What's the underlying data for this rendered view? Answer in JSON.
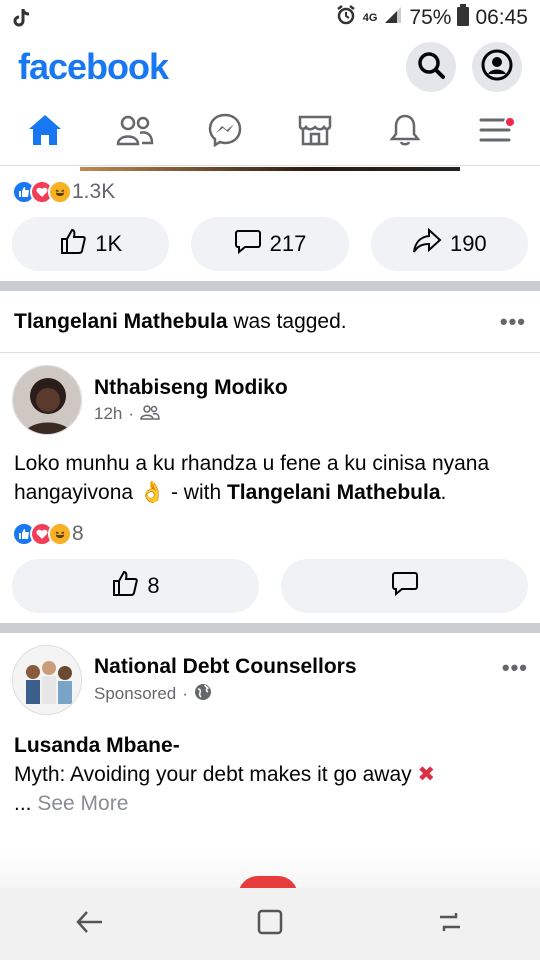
{
  "status": {
    "network": "4G",
    "battery": "75%",
    "time": "06:45"
  },
  "header": {
    "logo": "facebook",
    "search_icon": "search-icon",
    "profile_icon": "profile-icon"
  },
  "tabs": [
    "home-icon",
    "friends-icon",
    "messenger-icon",
    "marketplace-icon",
    "notifications-icon",
    "menu-icon"
  ],
  "post1": {
    "reaction_count": "1.3K",
    "like_count": "1K",
    "comment_count": "217",
    "share_count": "190"
  },
  "post2": {
    "tag_user": "Tlangelani Mathebula",
    "tag_text": "was tagged.",
    "author": "Nthabiseng Modiko",
    "time": "12h",
    "text": "Loko munhu a ku rhandza u fene a ku cinisa nyana hangayivona",
    "with_label": "- with",
    "with_user": "Tlangelani Mathebula",
    "end": ".",
    "reaction_count": "8",
    "like_count": "8"
  },
  "post3": {
    "author": "National Debt Counsellors",
    "sponsored": "Sponsored",
    "title": "Lusanda Mbane-",
    "text": "Myth: Avoiding your debt makes it go away",
    "ellipsis": "...",
    "see_more": "See More"
  },
  "colors": {
    "brand": "#1877f2",
    "pill_bg": "#f0f2f5",
    "separator": "#c9ccd1",
    "badge": "#f02849"
  }
}
